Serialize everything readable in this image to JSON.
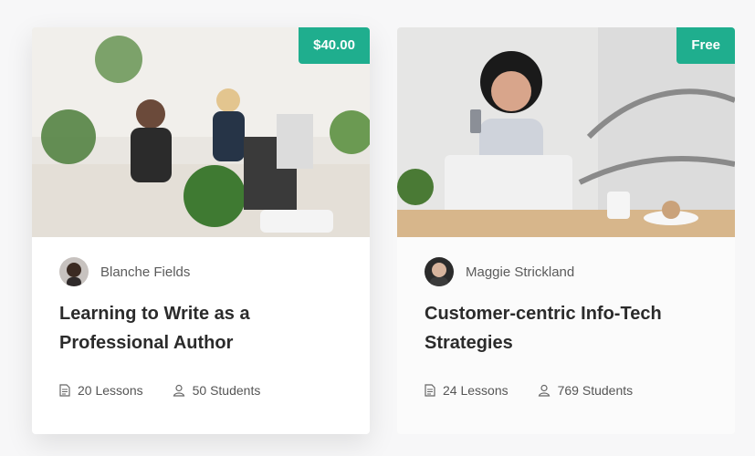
{
  "courses": [
    {
      "price": "$40.00",
      "author": "Blanche Fields",
      "title": "Learning to Write as a Professional Author",
      "lessons": "20 Lessons",
      "students": "50 Students"
    },
    {
      "price": "Free",
      "author": "Maggie Strickland",
      "title": "Customer-centric Info-Tech Strategies",
      "lessons": "24 Lessons",
      "students": "769 Students"
    }
  ],
  "colors": {
    "accent": "#1fae8e",
    "title": "#2b2b2b",
    "meta": "#555555"
  }
}
